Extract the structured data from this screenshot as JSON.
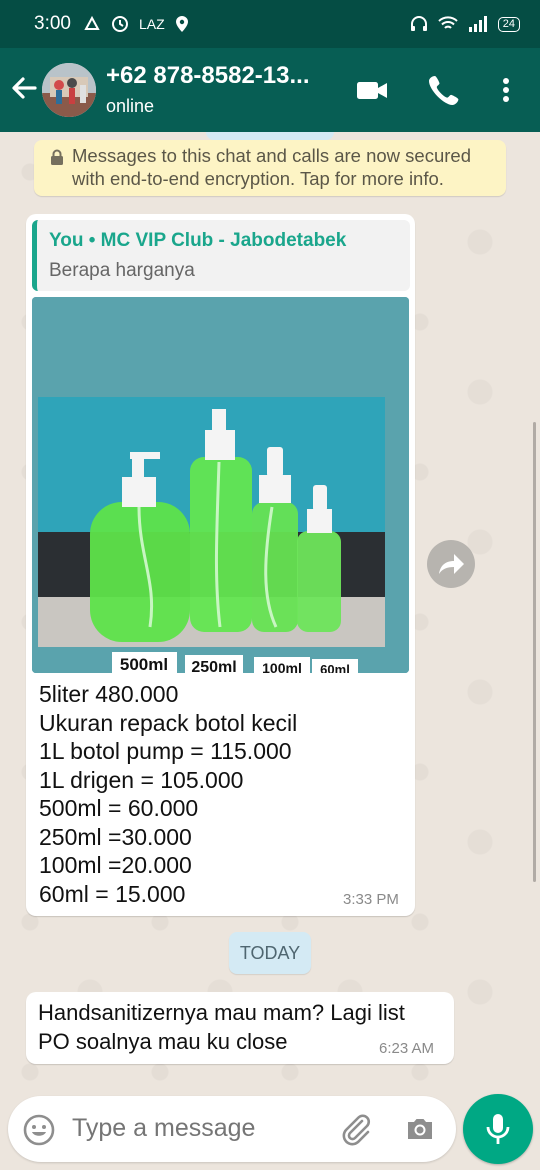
{
  "status_bar": {
    "time": "3:00",
    "carrier_badge": "LAZ",
    "battery": "24"
  },
  "header": {
    "contact_name": "+62 878-8582-13...",
    "contact_status": "online"
  },
  "chat": {
    "encryption_notice": "Messages to this chat and calls are now secured with end-to-end encryption. Tap for more info.",
    "messages": [
      {
        "quote_author": "You • MC VIP Club - Jabodetabek",
        "quote_text": "Berapa harganya",
        "photo_labels": [
          "500ml",
          "250ml",
          "100ml",
          "60ml"
        ],
        "lines": [
          "5liter 480.000",
          "Ukuran repack botol kecil",
          "1L botol pump = 115.000",
          "1L drigen = 105.000",
          "500ml = 60.000",
          "250ml =30.000",
          "100ml =20.000",
          "60ml = 15.000"
        ],
        "time": "3:33 PM"
      },
      {
        "lines": [
          "Handsanitizernya mau mam? Lagi list",
          "PO soalnya mau ku close"
        ],
        "time": "6:23 AM"
      }
    ],
    "date_divider": "TODAY"
  },
  "input": {
    "placeholder": "Type a message"
  },
  "icons": {
    "back": "arrow-left-icon",
    "video": "video-call-icon",
    "call": "phone-icon",
    "menu": "more-vertical-icon",
    "emoji": "emoji-icon",
    "attach": "paperclip-icon",
    "camera": "camera-icon",
    "mic": "mic-icon",
    "forward": "forward-icon"
  },
  "colors": {
    "header": "#075e54",
    "status_bar": "#054d44",
    "accent": "#00a884",
    "quote_accent": "#1aa68c",
    "notice_bg": "#fdf4c5"
  }
}
